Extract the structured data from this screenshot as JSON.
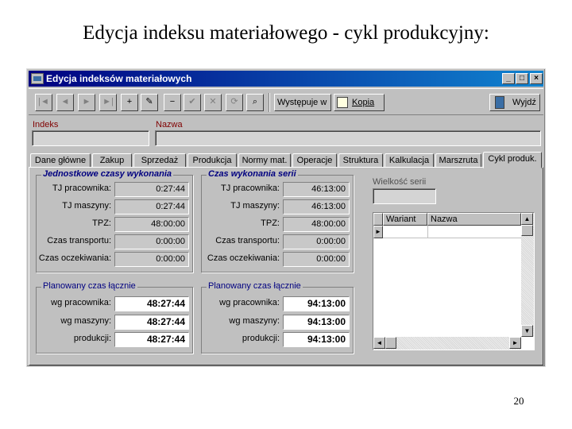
{
  "slide": {
    "title": "Edycja indeksu materiałowego - cykl produkcyjny:",
    "page_number": "20"
  },
  "window": {
    "title": "Edycja indeksów materiałowych",
    "controls": [
      "_",
      "□",
      "×"
    ]
  },
  "toolbar": {
    "nav_first": "|◄",
    "nav_prev": "◄",
    "nav_next": "►",
    "nav_last": "►|",
    "add": "+",
    "edit": "✎",
    "remove": "−",
    "confirm": "✔",
    "cancel": "✕",
    "refresh": "⟳",
    "find": "⌕",
    "occurs_label": "Występuje w",
    "copy_label": "Kopia",
    "exit_label": "Wyjdź"
  },
  "fields": {
    "index_label": "Indeks",
    "name_label": "Nazwa"
  },
  "tabs": [
    {
      "label": "Dane główne"
    },
    {
      "label": "Zakup"
    },
    {
      "label": "Sprzedaż"
    },
    {
      "label": "Produkcja"
    },
    {
      "label": "Normy mat."
    },
    {
      "label": "Operacje"
    },
    {
      "label": "Struktura"
    },
    {
      "label": "Kalkulacja"
    },
    {
      "label": "Marszruta"
    },
    {
      "label": "Cykl produk."
    }
  ],
  "unit_times": {
    "title": "Jednostkowe czasy wykonania",
    "rows": [
      {
        "label": "TJ pracownika:",
        "value": "0:27:44"
      },
      {
        "label": "TJ maszyny:",
        "value": "0:27:44"
      },
      {
        "label": "TPZ:",
        "value": "48:00:00"
      },
      {
        "label": "Czas transportu:",
        "value": "0:00:00"
      },
      {
        "label": "Czas oczekiwania:",
        "value": "0:00:00"
      }
    ]
  },
  "series_times": {
    "title": "Czas wykonania serii",
    "rows": [
      {
        "label": "TJ pracownika:",
        "value": "46:13:00"
      },
      {
        "label": "TJ maszyny:",
        "value": "46:13:00"
      },
      {
        "label": "TPZ:",
        "value": "48:00:00"
      },
      {
        "label": "Czas transportu:",
        "value": "0:00:00"
      },
      {
        "label": "Czas oczekiwania:",
        "value": "0:00:00"
      }
    ]
  },
  "planned_left": {
    "title": "Planowany czas łącznie",
    "rows": [
      {
        "label": "wg pracownika:",
        "value": "48:27:44"
      },
      {
        "label": "wg maszyny:",
        "value": "48:27:44"
      },
      {
        "label": "produkcji:",
        "value": "48:27:44"
      }
    ]
  },
  "planned_right": {
    "title": "Planowany czas łącznie",
    "rows": [
      {
        "label": "wg pracownika:",
        "value": "94:13:00"
      },
      {
        "label": "wg maszyny:",
        "value": "94:13:00"
      },
      {
        "label": "produkcji:",
        "value": "94:13:00"
      }
    ]
  },
  "series_size": {
    "label": "Wielkość serii"
  },
  "variants_grid": {
    "columns": [
      "Wariant",
      "Nazwa"
    ],
    "row_marker": "►",
    "scroll_up": "▲",
    "scroll_down": "▼",
    "scroll_left": "◄",
    "scroll_right": "►"
  }
}
